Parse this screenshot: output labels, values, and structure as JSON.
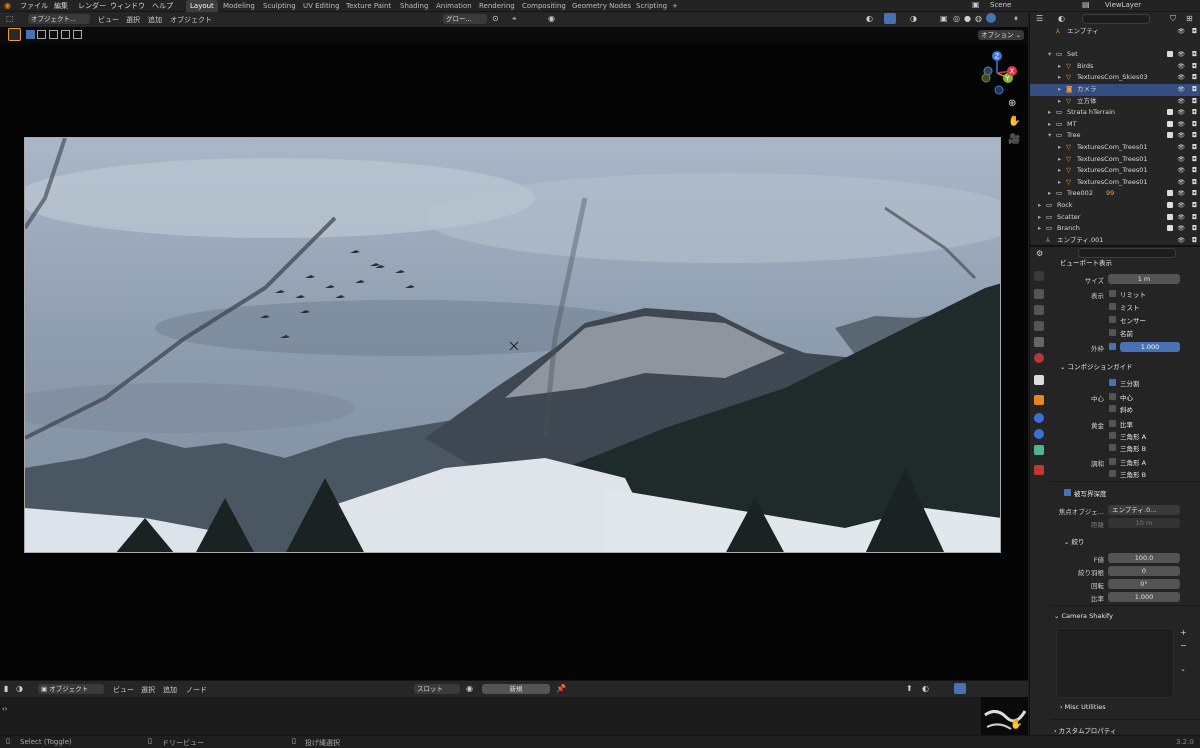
{
  "topbar": {
    "menus": [
      "ファイル",
      "編集",
      "レンダー",
      "ウィンドウ",
      "ヘルプ"
    ],
    "workspaces": [
      "Layout",
      "Modeling",
      "Sculpting",
      "UV Editing",
      "Texture Paint",
      "Shading",
      "Animation",
      "Rendering",
      "Compositing",
      "Geometry Nodes",
      "Scripting"
    ],
    "active_workspace": "Layout",
    "add_tab": "+",
    "scene": "Scene",
    "view_layer": "ViewLayer"
  },
  "viewport_header": {
    "mode": "オブジェクト...",
    "menus": [
      "ビュー",
      "選択",
      "追加",
      "オブジェクト"
    ],
    "transform": "グロー...",
    "options": "オプション"
  },
  "gizmo": {
    "z": "Z",
    "y": "Y",
    "x": "X"
  },
  "outliner": {
    "search_placeholder": "",
    "rows": [
      {
        "label": "エンプティ",
        "indent": 2,
        "icon": "empty",
        "tri": ""
      },
      {
        "label": "",
        "indent": 1,
        "icon": "",
        "tri": ""
      },
      {
        "label": "Set",
        "indent": 2,
        "icon": "collection",
        "tri": "▾"
      },
      {
        "label": "Birds",
        "indent": 3,
        "icon": "mesh",
        "tri": "▸"
      },
      {
        "label": "TexturesCom_Skies03",
        "indent": 3,
        "icon": "mesh",
        "tri": "▸"
      },
      {
        "label": "カメラ",
        "indent": 3,
        "icon": "camera",
        "tri": "▸",
        "selected": true
      },
      {
        "label": "立方体",
        "indent": 3,
        "icon": "mesh",
        "tri": "▸"
      },
      {
        "label": "Strata hTerrain",
        "indent": 2,
        "icon": "collection",
        "tri": "▸"
      },
      {
        "label": "MT",
        "indent": 2,
        "icon": "collection",
        "tri": "▸"
      },
      {
        "label": "Tree",
        "indent": 2,
        "icon": "collection",
        "tri": "▾"
      },
      {
        "label": "TexturesCom_Trees01",
        "indent": 3,
        "icon": "mesh",
        "tri": "▸"
      },
      {
        "label": "TexturesCom_Trees01",
        "indent": 3,
        "icon": "mesh",
        "tri": "▸"
      },
      {
        "label": "TexturesCom_Trees01",
        "indent": 3,
        "icon": "mesh",
        "tri": "▸"
      },
      {
        "label": "TexturesCom_Trees01",
        "indent": 3,
        "icon": "mesh",
        "tri": "▸"
      },
      {
        "label": "Tree002",
        "indent": 2,
        "icon": "collection",
        "tri": "▸",
        "badge": "99"
      },
      {
        "label": "Rock",
        "indent": 1,
        "icon": "collection",
        "tri": "▸"
      },
      {
        "label": "Scatter",
        "indent": 1,
        "icon": "collection",
        "tri": "▸"
      },
      {
        "label": "Branch",
        "indent": 1,
        "icon": "collection",
        "tri": "▸"
      },
      {
        "label": "エンプティ.001",
        "indent": 1,
        "icon": "empty",
        "tri": ""
      },
      {
        "label": "球...",
        "indent": 1,
        "icon": "mesh",
        "tri": "▸"
      }
    ]
  },
  "properties": {
    "viewport_display_header": "ビューポート表示",
    "size_label": "サイズ",
    "size_value": "1 m",
    "display_label": "表示",
    "limits": "リミット",
    "mist": "ミスト",
    "sensor": "センサー",
    "name": "名前",
    "passepartout_label": "外枠",
    "passepartout_value": "1.000",
    "composition_header": "コンポジションガイド",
    "thirds": "三分割",
    "center_label": "中心",
    "center": "中心",
    "diagonal": "斜め",
    "golden_label": "黄金",
    "ratio": "比率",
    "triangle_a": "三角形 A",
    "triangle_b": "三角形 B",
    "harmony_label": "調和",
    "harmony_a": "三角形 A",
    "harmony_b": "三角形 B",
    "dof_header": "被写界深度",
    "focus_object_label": "焦点オブジェ...",
    "focus_object_value": "エンプティ.0...",
    "distance_label": "距離",
    "distance_value": "10 m",
    "aperture_header": "絞り",
    "fstop_label": "F値",
    "fstop_value": "100.0",
    "blades_label": "絞り羽根",
    "blades_value": "0",
    "rotation_label": "回転",
    "rotation_value": "0°",
    "ratio_label": "比率",
    "ratio_value": "1.000",
    "camera_shakify_header": "Camera Shakify",
    "misc_header": "Misc Utilities",
    "custom_props_header": "カスタムプロパティ"
  },
  "node_editor": {
    "mode": "オブジェクト",
    "menus": [
      "ビュー",
      "選択",
      "追加",
      "ノード"
    ],
    "slot": "スロット",
    "new_button": "新規"
  },
  "statusbar": {
    "select": "Select (Toggle)",
    "dolly": "ドリービュー",
    "lasso": "投げ縄選択",
    "version": "3.2.0"
  },
  "colors": {
    "accent": "#4772b3",
    "selection": "#334d80",
    "orange_icon": "#f29e4c",
    "green_icon": "#4fb39a"
  }
}
